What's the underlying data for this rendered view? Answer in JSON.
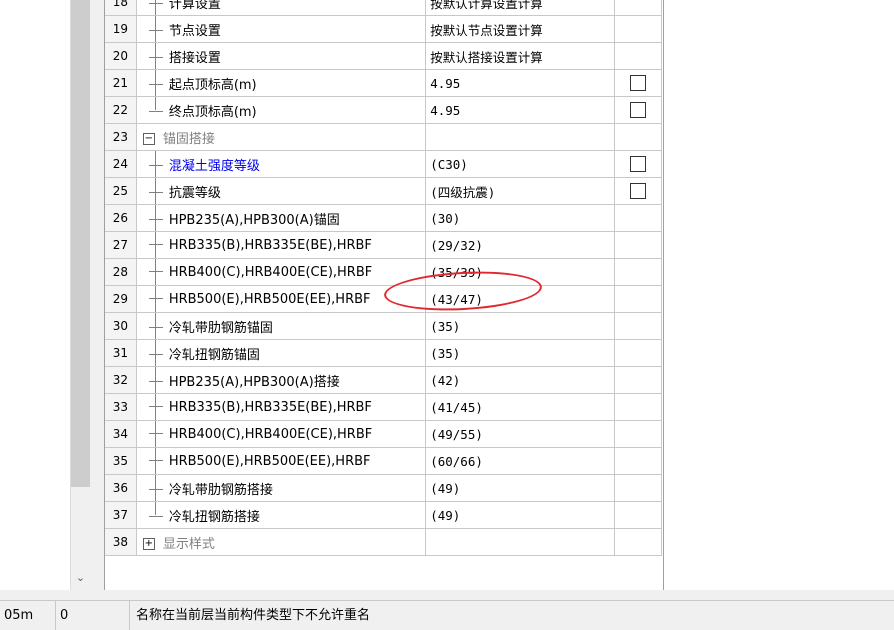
{
  "rows": [
    {
      "num": "18",
      "name": "计算设置",
      "value": "按默认计算设置计算",
      "check": false,
      "style": "child"
    },
    {
      "num": "19",
      "name": "节点设置",
      "value": "按默认节点设置计算",
      "check": false,
      "style": "child"
    },
    {
      "num": "20",
      "name": "搭接设置",
      "value": "按默认搭接设置计算",
      "check": false,
      "style": "child"
    },
    {
      "num": "21",
      "name": "起点顶标高(m)",
      "value": "4.95",
      "check": true,
      "style": "child"
    },
    {
      "num": "22",
      "name": "终点顶标高(m)",
      "value": "4.95",
      "check": true,
      "style": "child-last"
    },
    {
      "num": "23",
      "name": "锚固搭接",
      "value": "",
      "check": false,
      "style": "group-open"
    },
    {
      "num": "24",
      "name": "混凝土强度等级",
      "value": "(C30)",
      "check": true,
      "style": "child-blue"
    },
    {
      "num": "25",
      "name": "抗震等级",
      "value": "(四级抗震)",
      "check": true,
      "style": "child"
    },
    {
      "num": "26",
      "name": "HPB235(A),HPB300(A)锚固",
      "value": "(30)",
      "check": false,
      "style": "child"
    },
    {
      "num": "27",
      "name": "HRB335(B),HRB335E(BE),HRBF",
      "value": "(29/32)",
      "check": false,
      "style": "child"
    },
    {
      "num": "28",
      "name": "HRB400(C),HRB400E(CE),HRBF",
      "value": "(35/39)",
      "check": false,
      "style": "child"
    },
    {
      "num": "29",
      "name": "HRB500(E),HRB500E(EE),HRBF",
      "value": "(43/47)",
      "check": false,
      "style": "child"
    },
    {
      "num": "30",
      "name": "冷轧带肋钢筋锚固",
      "value": "(35)",
      "check": false,
      "style": "child"
    },
    {
      "num": "31",
      "name": "冷轧扭钢筋锚固",
      "value": "(35)",
      "check": false,
      "style": "child"
    },
    {
      "num": "32",
      "name": "HPB235(A),HPB300(A)搭接",
      "value": "(42)",
      "check": false,
      "style": "child"
    },
    {
      "num": "33",
      "name": "HRB335(B),HRB335E(BE),HRBF",
      "value": "(41/45)",
      "check": false,
      "style": "child"
    },
    {
      "num": "34",
      "name": "HRB400(C),HRB400E(CE),HRBF",
      "value": "(49/55)",
      "check": false,
      "style": "child"
    },
    {
      "num": "35",
      "name": "HRB500(E),HRB500E(EE),HRBF",
      "value": "(60/66)",
      "check": false,
      "style": "child"
    },
    {
      "num": "36",
      "name": "冷轧带肋钢筋搭接",
      "value": "(49)",
      "check": false,
      "style": "child"
    },
    {
      "num": "37",
      "name": "冷轧扭钢筋搭接",
      "value": "(49)",
      "check": false,
      "style": "child-last"
    },
    {
      "num": "38",
      "name": "显示样式",
      "value": "",
      "check": false,
      "style": "group-closed"
    }
  ],
  "status": {
    "cell1": "05m",
    "cell2": "0",
    "message": "名称在当前层当前构件类型下不允许重名"
  },
  "colors": {
    "accent_blue": "#0000ee",
    "annotation_red": "#e0282e"
  }
}
